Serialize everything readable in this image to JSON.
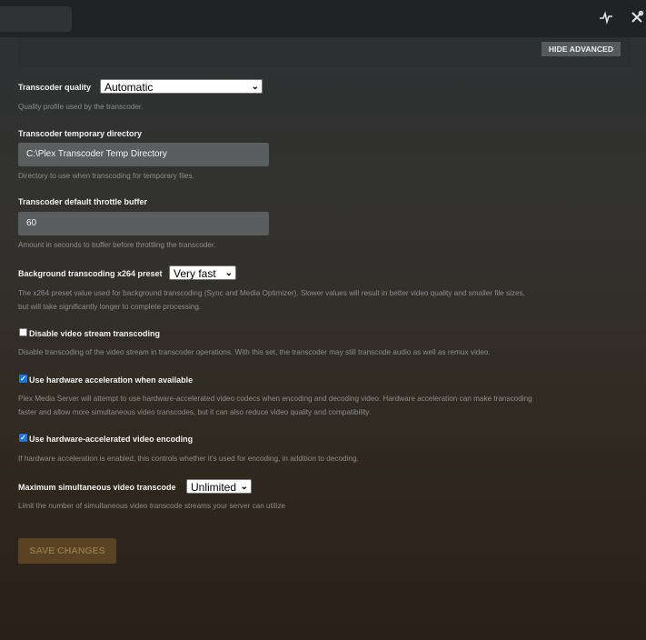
{
  "topbar": {
    "activity_icon": "activity-icon",
    "settings_icon": "wrench-screwdriver-icon"
  },
  "advanced": {
    "hide_label": "HIDE ADVANCED"
  },
  "transcoder_quality": {
    "label": "Transcoder quality",
    "value": "Automatic",
    "help": "Quality profile used by the transcoder."
  },
  "temp_directory": {
    "label": "Transcoder temporary directory",
    "value": "C:\\Plex Transcoder Temp Directory",
    "help": "Directory to use when transcoding for temporary files."
  },
  "throttle_buffer": {
    "label": "Transcoder default throttle buffer",
    "value": "60",
    "help": "Amount in seconds to buffer before throttling the transcoder."
  },
  "x264_preset": {
    "label": "Background transcoding x264 preset",
    "value": "Very fast",
    "help_line1": "The x264 preset value used for background transcoding (Sync and Media Optimizer). Slower values will result in better video quality and smaller file sizes,",
    "help_line2": "but will take significantly longer to complete processing."
  },
  "disable_video_stream": {
    "label": "Disable video stream transcoding",
    "checked": false,
    "help": "Disable transcoding of the video stream in transcoder operations. With this set, the transcoder may still transcode audio as well as remux video."
  },
  "hw_acceleration": {
    "label": "Use hardware acceleration when available",
    "checked": true,
    "help_line1": "Plex Media Server will attempt to use hardware-accelerated video codecs when encoding and decoding video. Hardware acceleration can make transcoding",
    "help_line2": "faster and allow more simultaneous video transcodes, but it can also reduce video quality and compatibility."
  },
  "hw_encoding": {
    "label": "Use hardware-accelerated video encoding",
    "checked": true,
    "help": "If hardware acceleration is enabled, this controls whether it's used for encoding, in addition to decoding."
  },
  "max_transcode": {
    "label": "Maximum simultaneous video transcode",
    "value": "Unlimited",
    "help": "Limit the number of simultaneous video transcode streams your server can utilize"
  },
  "save_label": "SAVE CHANGES",
  "colors": {
    "accent_disabled": "#5a4322",
    "checkbox_blue": "#1a73e8"
  }
}
